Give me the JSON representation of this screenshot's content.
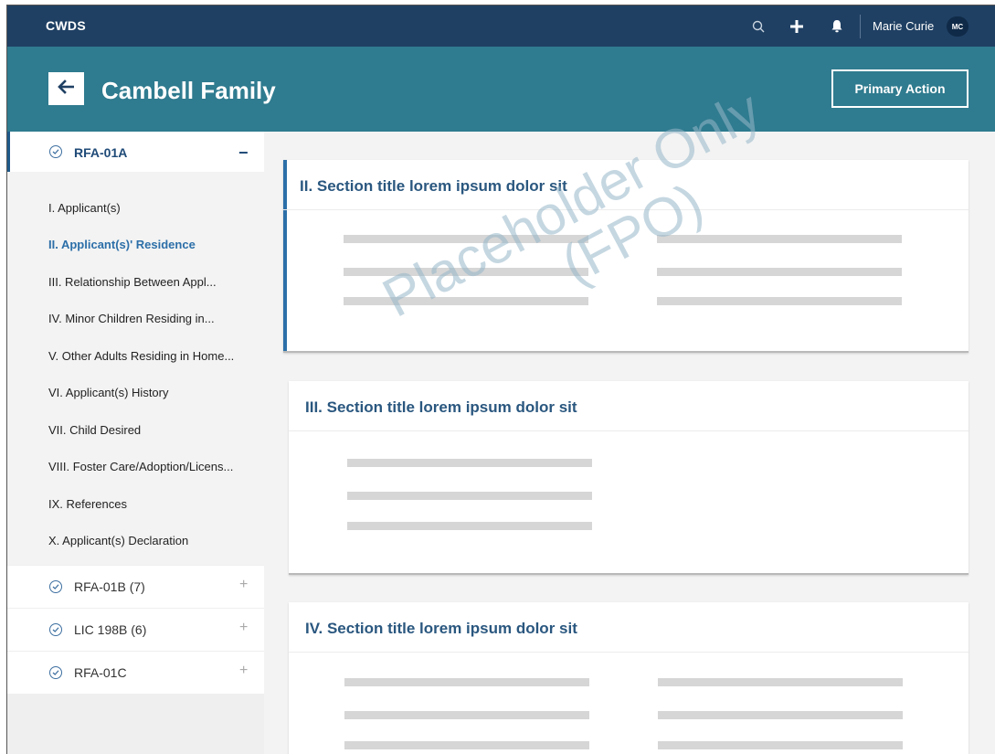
{
  "topbar": {
    "brand": "CWDS",
    "user_name": "Marie Curie",
    "avatar_initials": "MC",
    "icons": [
      "search-icon",
      "plus-icon",
      "bell-icon"
    ]
  },
  "header": {
    "title": "Cambell Family",
    "primary_action": "Primary Action",
    "back_icon": "arrow-left-icon"
  },
  "sidebar": {
    "active_group": {
      "label": "RFA-01A",
      "collapse_symbol": "−",
      "items": [
        {
          "label": "I. Applicant(s)",
          "active": false
        },
        {
          "label": "II. Applicant(s)' Residence",
          "active": true
        },
        {
          "label": "III. Relationship Between Appl...",
          "active": false
        },
        {
          "label": "IV. Minor Children Residing in...",
          "active": false
        },
        {
          "label": "V. Other Adults Residing in Home...",
          "active": false
        },
        {
          "label": "VI. Applicant(s) History",
          "active": false
        },
        {
          "label": "VII. Child Desired",
          "active": false
        },
        {
          "label": "VIII. Foster Care/Adoption/Licens...",
          "active": false
        },
        {
          "label": "IX. References",
          "active": false
        },
        {
          "label": "X. Applicant(s) Declaration",
          "active": false
        }
      ]
    },
    "groups": [
      {
        "label": "RFA-01B (7)",
        "expand_symbol": "+"
      },
      {
        "label": "LIC 198B (6)",
        "expand_symbol": "+"
      },
      {
        "label": "RFA-01C",
        "expand_symbol": "+"
      }
    ]
  },
  "main": {
    "sections": [
      {
        "title": "II. Section title lorem ipsum dolor sit"
      },
      {
        "title": "III. Section title lorem ipsum dolor sit"
      },
      {
        "title": "IV. Section title lorem ipsum dolor sit"
      }
    ],
    "watermark": [
      "Placeholder Only",
      "(FPO)"
    ]
  },
  "colors": {
    "topbar": "#1f4063",
    "header": "#2f7b8f",
    "accent": "#2c6fa8",
    "section_title": "#2a577f"
  }
}
